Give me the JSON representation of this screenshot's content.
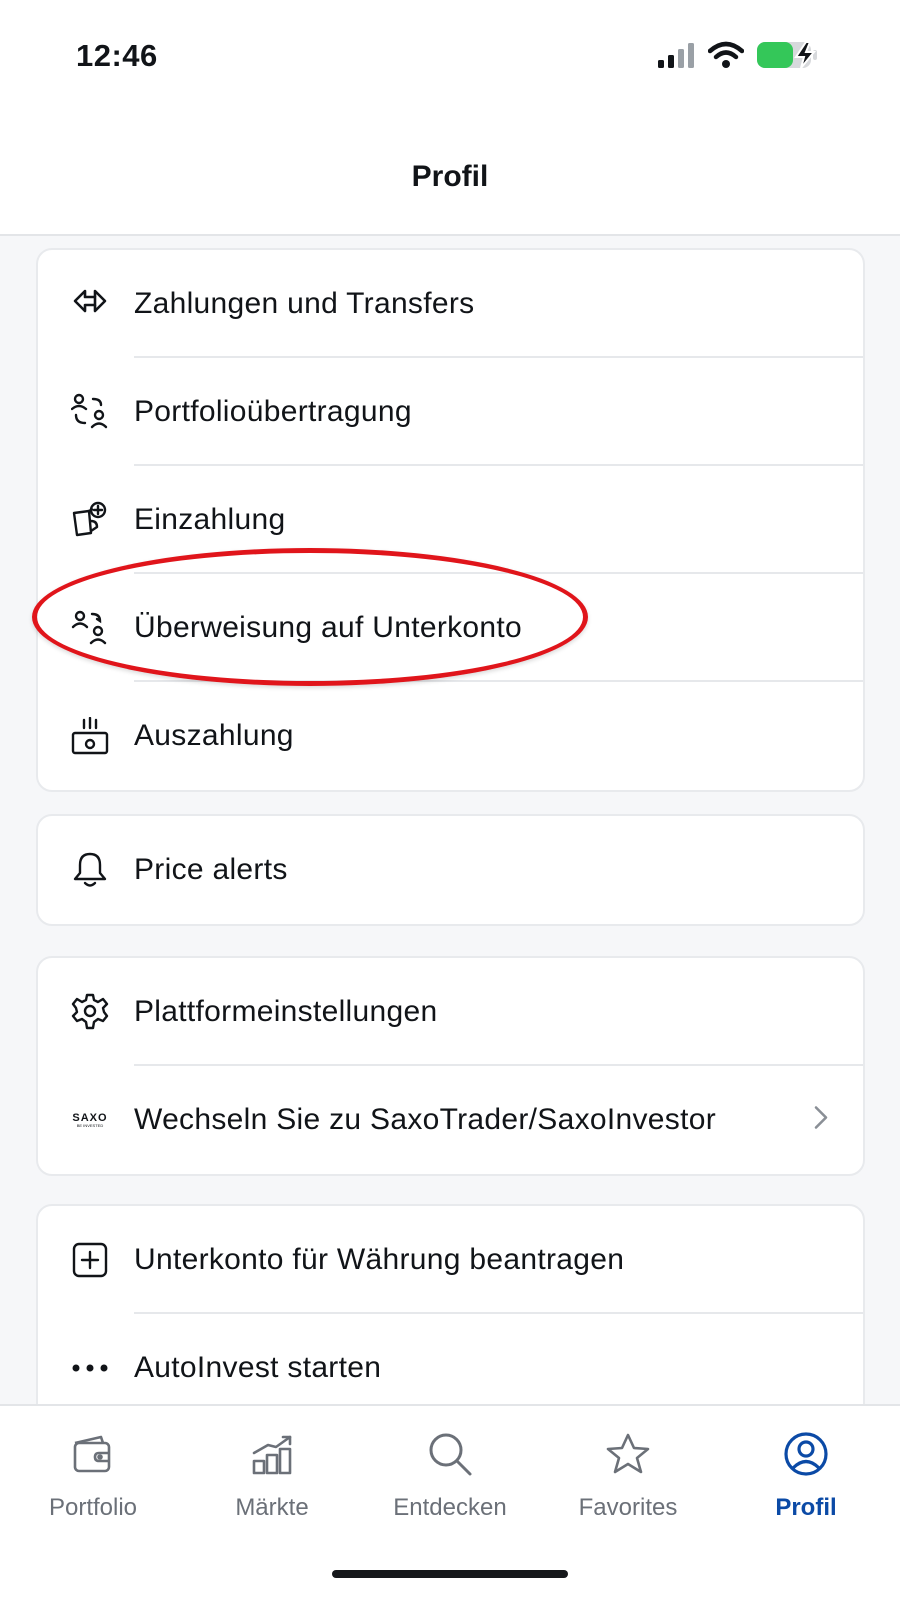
{
  "status_bar": {
    "time": "12:46",
    "signal_icon": "cellular-signal-icon",
    "wifi_icon": "wifi-icon",
    "battery_icon": "battery-charging-icon",
    "battery_color": "#34c759"
  },
  "header": {
    "title": "Profil"
  },
  "cards": [
    {
      "items": [
        {
          "icon": "arrows-left-right-icon",
          "label": "Zahlungen und Transfers"
        },
        {
          "icon": "people-transfer-icon",
          "label": "Portfolioübertragung"
        },
        {
          "icon": "wallet-plus-icon",
          "label": "Einzahlung"
        },
        {
          "icon": "person-transfer-icon",
          "label": "Überweisung auf Unterkonto"
        },
        {
          "icon": "cash-withdraw-icon",
          "label": "Auszahlung"
        }
      ]
    },
    {
      "items": [
        {
          "icon": "bell-icon",
          "label": "Price alerts"
        }
      ]
    },
    {
      "items": [
        {
          "icon": "gear-icon",
          "label": "Plattformeinstellungen"
        },
        {
          "icon": "saxo-logo",
          "logo_text": "SAXO",
          "logo_subtext": "BE INVESTED",
          "label": "Wechseln Sie zu SaxoTrader/SaxoInvestor",
          "chevron_icon": "chevron-right-icon"
        }
      ]
    },
    {
      "items": [
        {
          "icon": "plus-square-icon",
          "label": "Unterkonto für Währung beantragen"
        },
        {
          "icon": "more-dots-icon",
          "label": "AutoInvest starten"
        }
      ]
    }
  ],
  "annotation": {
    "highlight_color": "#e0151b",
    "highlighted_item": "Überweisung auf Unterkonto"
  },
  "tabbar": {
    "active_color": "#0b4aa6",
    "inactive_color": "#6b7078",
    "tabs": [
      {
        "icon": "wallet-icon",
        "label": "Portfolio",
        "active": false
      },
      {
        "icon": "chart-growth-icon",
        "label": "Märkte",
        "active": false
      },
      {
        "icon": "search-icon",
        "label": "Entdecken",
        "active": false
      },
      {
        "icon": "star-icon",
        "label": "Favorites",
        "active": false
      },
      {
        "icon": "profile-icon",
        "label": "Profil",
        "active": true
      }
    ]
  }
}
